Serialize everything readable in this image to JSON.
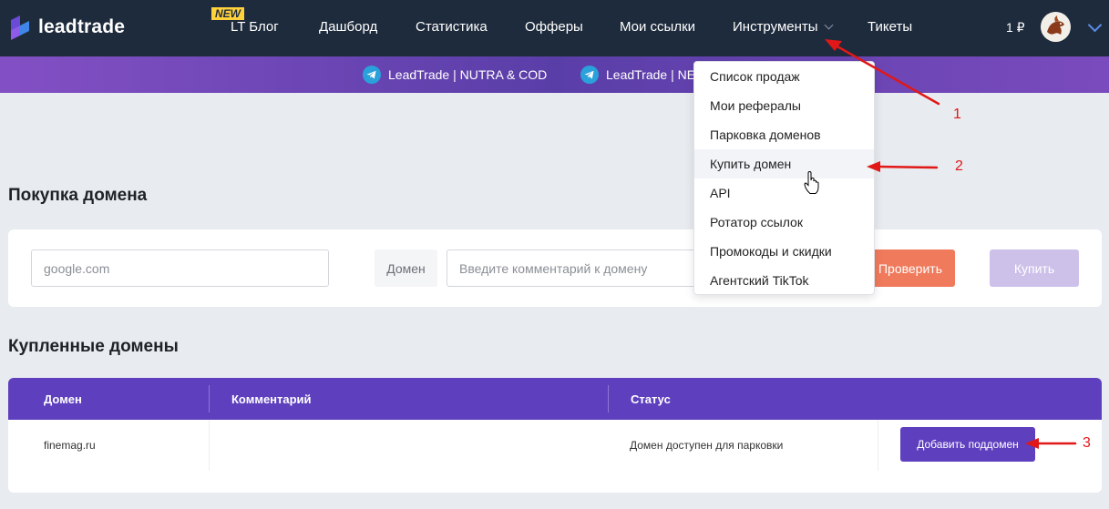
{
  "nav": {
    "logo": "leadtrade",
    "badge": "NEW",
    "items": [
      "LT Блог",
      "Дашборд",
      "Статистика",
      "Офферы",
      "Мои ссылки",
      "Инструменты",
      "Тикеты"
    ],
    "balance": "1 ₽"
  },
  "band": {
    "channels": [
      "LeadTrade | NUTRA & COD",
      "LeadTrade | NE"
    ]
  },
  "purchase": {
    "title": "Покупка домена",
    "domain_placeholder": "google.com",
    "prefix": "Домен",
    "comment_placeholder": "Введите комментарий к домену",
    "check_label": "Проверить",
    "buy_label": "Купить"
  },
  "purchased": {
    "title": "Купленные домены",
    "columns": [
      "Домен",
      "Комментарий",
      "Статус"
    ],
    "rows": [
      {
        "domain": "finemag.ru",
        "comment": "",
        "status": "Домен доступен для парковки",
        "action": "Добавить поддомен"
      }
    ]
  },
  "dropdown": {
    "items": [
      "Список продаж",
      "Мои рефералы",
      "Парковка доменов",
      "Купить домен",
      "API",
      "Ротатор ссылок",
      "Промокоды и скидки",
      "Агентский TikTok"
    ],
    "hovered_index": 3
  },
  "annotations": [
    "1",
    "2",
    "3"
  ],
  "colors": {
    "nav_bg": "#1e2b3c",
    "accent": "#5e3fbe",
    "check_button": "#f07a5c",
    "buy_button": "#cdc1ea",
    "annotation": "#e01818",
    "telegram": "#2aa1da"
  },
  "icons": [
    "leadtrade-logo-icon",
    "telegram-icon",
    "chevron-down-icon",
    "avatar",
    "hand-cursor-icon",
    "arrow-annotation"
  ]
}
